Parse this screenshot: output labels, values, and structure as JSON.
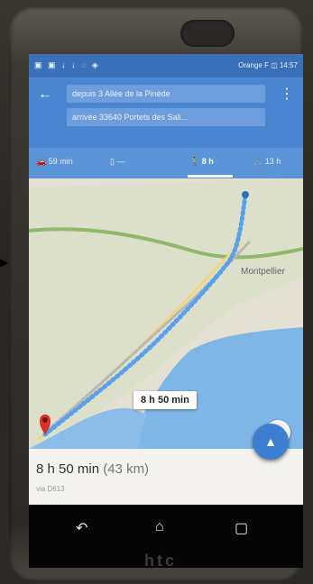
{
  "status_bar": {
    "left_icons": "▣ ▣ ↓ ↓ ◌ ◈",
    "right_text": "Orange F ◫ 14:57"
  },
  "header": {
    "from": "depuis 3 Allée de la Pinède",
    "to": "arrivée 33640 Portets des Sali..."
  },
  "modes": [
    {
      "label": "59 min"
    },
    {
      "label": "—"
    },
    {
      "label": "8 h"
    },
    {
      "label": "13 h"
    }
  ],
  "map": {
    "route_duration_label": "8 h 50 min",
    "place_label": "Montpellier"
  },
  "summary": {
    "duration": "8 h 50 min",
    "distance": "(43 km)",
    "via": "via D613"
  },
  "brand": "htc",
  "colors": {
    "header_blue": "#4a86cf",
    "route_blue": "#5aa0ea",
    "pin_red": "#d8332b"
  }
}
